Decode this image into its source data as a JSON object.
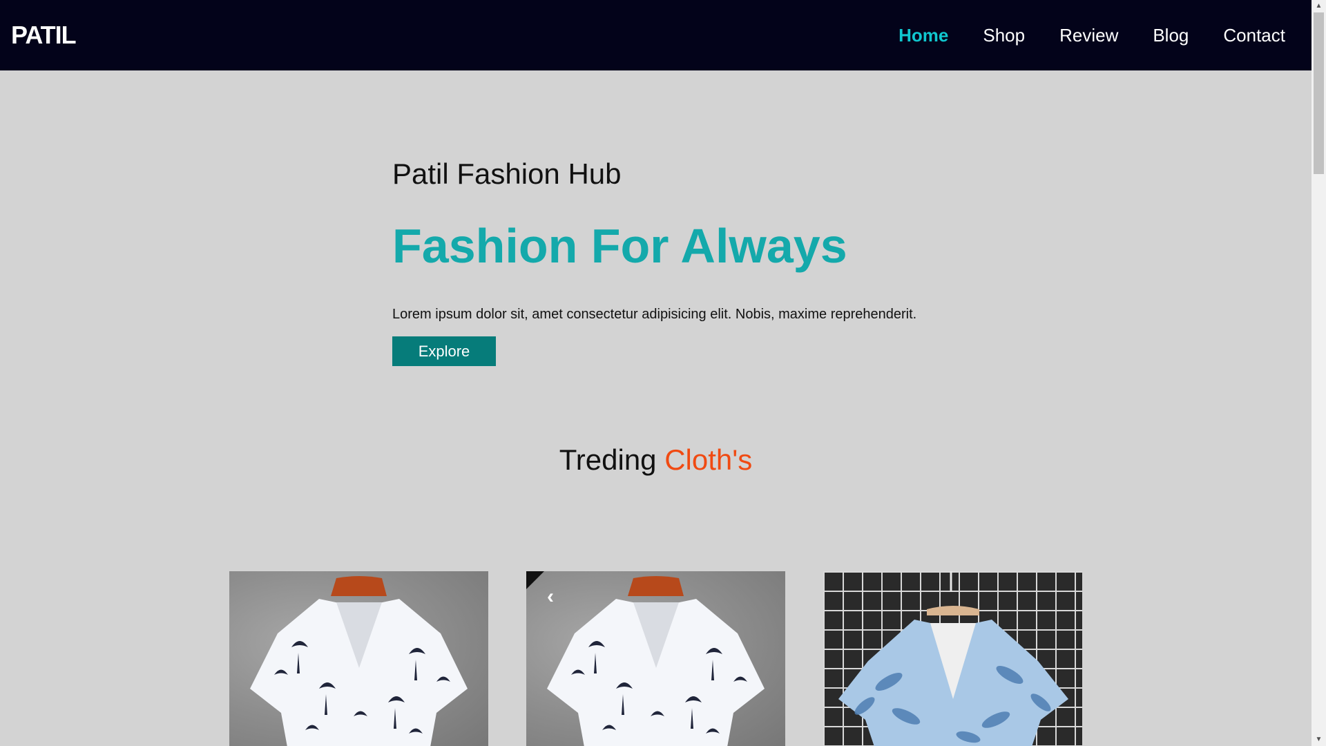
{
  "nav": {
    "brand": "PATIL",
    "links": [
      {
        "label": "Home",
        "active": true
      },
      {
        "label": "Shop",
        "active": false
      },
      {
        "label": "Review",
        "active": false
      },
      {
        "label": "Blog",
        "active": false
      },
      {
        "label": "Contact",
        "active": false
      }
    ]
  },
  "hero": {
    "subtitle": "Patil Fashion Hub",
    "title": "Fashion For Always",
    "text": "Lorem ipsum dolor sit, amet consectetur adipisicing elit. Nobis, maxime reprehenderit.",
    "button_label": "Explore"
  },
  "trending": {
    "heading_main": "Treding",
    "heading_accent": "Cloth's"
  },
  "products": [
    {
      "icon": "white-palm-print-shirt-icon"
    },
    {
      "icon": "white-palm-print-shirt-icon",
      "prev_arrow": "‹"
    },
    {
      "icon": "blue-leaf-print-shirt-icon"
    }
  ],
  "colors": {
    "nav_bg": "#03031a",
    "active_link": "#10c7cf",
    "hero_title": "#14a9ab",
    "button_bg": "#067c7a",
    "accent": "#f04a12",
    "page_bg": "#d3d3d3"
  }
}
